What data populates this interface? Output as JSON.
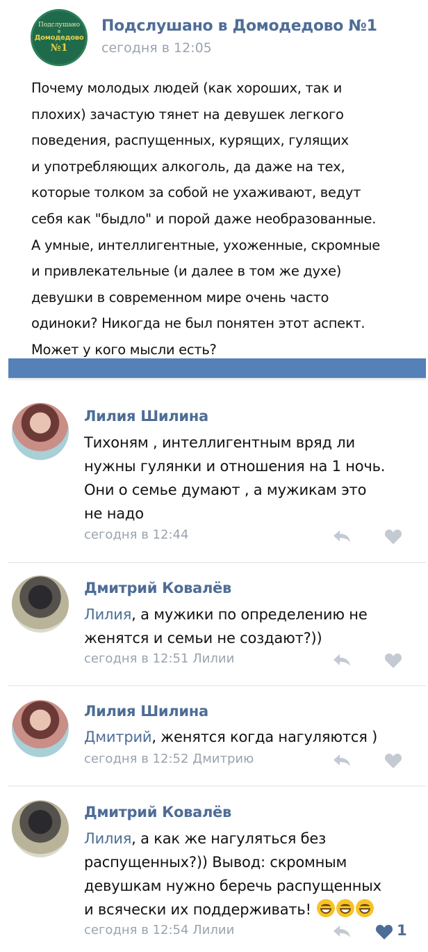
{
  "post": {
    "group_avatar": {
      "line1": "Подслушано",
      "line2": "в",
      "line3": "Домодедово",
      "line4": "№1"
    },
    "group_name": "Подслушано в Домодедово №1",
    "time": "сегодня в 12:05",
    "text_lines": [
      "Почему молодых людей (как хороших, так и",
      "плохих) зачастую тянет на девушек легкого",
      "поведения, распущенных, курящих, гулящих",
      "и употребляющих алкоголь, да даже на тех,",
      "которые толком за собой не ухаживают, ведут",
      "себя как \"быдло\" и порой даже необразованные.",
      "А умные, интеллигентные, ухоженные, скромные",
      "и привлекательные (и далее в том же духе)",
      "девушки в современном мире очень часто",
      "одиноки? Никогда не был понятен этот аспект.",
      "Может у кого мысли есть?"
    ]
  },
  "colors": {
    "accent": "#4e6d96",
    "bar": "#5580b8",
    "muted": "#9aa3ad"
  },
  "comments": [
    {
      "author": "Лилия Шилина",
      "avatar": "avatar-lilia",
      "lines": [
        "Тихоням , интеллигентным вряд ли",
        "нужны гулянки и отношения на 1 ночь.",
        "Они о семье думают , а мужикам это",
        "не надо"
      ],
      "time": "сегодня в 12:44"
    },
    {
      "author": "Дмитрий Ковалёв",
      "avatar": "avatar-dmitry",
      "mention": "Лилия",
      "first_line_rest": ", а мужики по определению не",
      "lines": [
        "женятся и семьи не создают?))"
      ],
      "time": "сегодня в 12:51 Лилии"
    },
    {
      "author": "Лилия Шилина",
      "avatar": "avatar-lilia",
      "mention": "Дмитрий",
      "first_line_rest": ", женятся когда нагуляются )",
      "time": "сегодня в 12:52 Дмитрию"
    },
    {
      "author": "Дмитрий Ковалёв",
      "avatar": "avatar-dmitry",
      "mention": "Лилия",
      "first_line_rest": ", а как же нагуляться без",
      "lines": [
        "распущенных?)) Вывод: скромным",
        "девушкам нужно беречь распущенных",
        "и всячески их поддерживать!"
      ],
      "emojis": [
        "grinning-face-emoji",
        "grinning-face-emoji",
        "grinning-face-emoji"
      ],
      "time": "сегодня в 12:54 Лилии",
      "likes": "1"
    }
  ],
  "icons": {
    "reply": "reply-arrow-icon",
    "like": "heart-icon"
  }
}
